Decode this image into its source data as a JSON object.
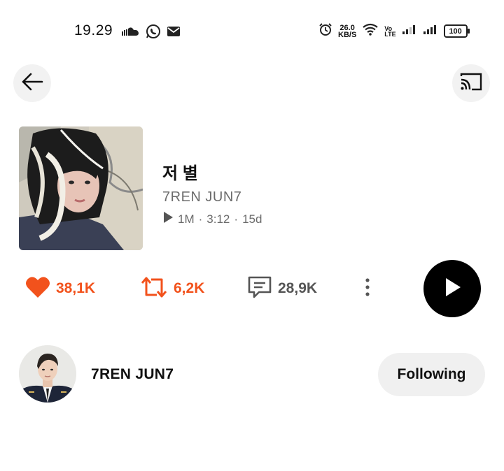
{
  "status_bar": {
    "time": "19.29",
    "net_speed_value": "26.0",
    "net_speed_unit": "KB/S",
    "volte_top": "Vo",
    "volte_bottom": "LTE",
    "battery": "100",
    "icons_left": [
      "soundcloud-icon",
      "whatsapp-icon",
      "mail-icon"
    ],
    "icons_right": [
      "alarm-icon",
      "wifi-icon",
      "signal-icon",
      "signal-icon"
    ]
  },
  "header": {
    "back_icon": "arrow-left-icon",
    "cast_icon": "cast-icon"
  },
  "track": {
    "title": "저 별",
    "artist": "7REN JUN7",
    "plays": "1M",
    "duration": "3:12",
    "age": "15d",
    "separator": "·"
  },
  "actions": {
    "likes": "38,1K",
    "reposts": "6,2K",
    "comments": "28,9K",
    "accent_color": "#f2521c"
  },
  "artist": {
    "name": "7REN JUN7",
    "follow_label": "Following"
  }
}
